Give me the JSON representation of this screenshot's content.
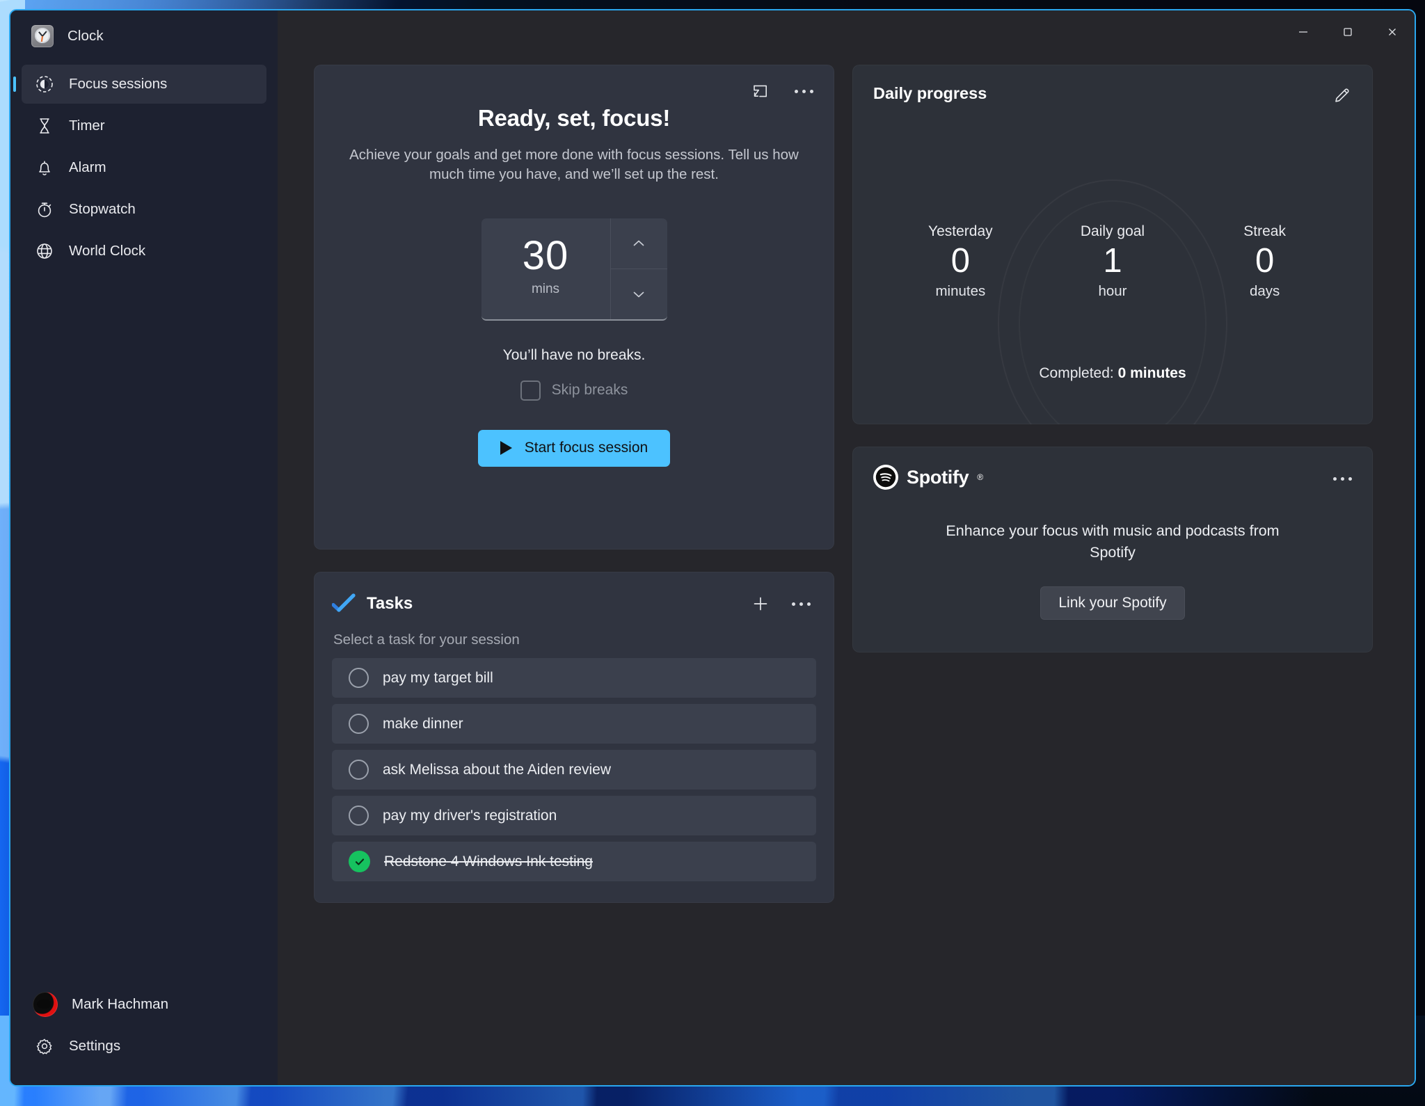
{
  "window": {
    "app_title": "Clock",
    "app_icon": "clock-icon",
    "controls": {
      "minimize": "minimize-icon",
      "maximize": "maximize-icon",
      "close": "close-icon"
    }
  },
  "sidebar": {
    "items": [
      {
        "label": "Focus sessions",
        "icon": "focus-sessions-icon",
        "active": true
      },
      {
        "label": "Timer",
        "icon": "hourglass-icon",
        "active": false
      },
      {
        "label": "Alarm",
        "icon": "bell-icon",
        "active": false
      },
      {
        "label": "Stopwatch",
        "icon": "stopwatch-icon",
        "active": false
      },
      {
        "label": "World Clock",
        "icon": "globe-icon",
        "active": false
      }
    ],
    "user": {
      "name": "Mark Hachman",
      "avatar": "user-avatar"
    },
    "settings": {
      "label": "Settings",
      "icon": "gear-icon"
    }
  },
  "focus": {
    "title": "Ready, set, focus!",
    "subtitle": "Achieve your goals and get more done with focus sessions. Tell us how much time you have, and we’ll set up the rest.",
    "duration_value": "30",
    "duration_unit": "mins",
    "increase_icon": "chevron-up-icon",
    "decrease_icon": "chevron-down-icon",
    "breaks_text": "You’ll have no breaks.",
    "skip_breaks_label": "Skip breaks",
    "skip_breaks_checked": false,
    "start_label": "Start focus session",
    "start_icon": "play-icon",
    "accent_color": "#4CC2FF",
    "compact_icon": "compact-overlay-icon",
    "more_icon": "more-options-icon"
  },
  "tasks": {
    "title": "Tasks",
    "logo_icon": "microsoft-todo-icon",
    "add_icon": "plus-icon",
    "more_icon": "more-options-icon",
    "subtitle": "Select a task for your session",
    "items": [
      {
        "label": "pay my target bill",
        "completed": false
      },
      {
        "label": "make dinner",
        "completed": false
      },
      {
        "label": "ask Melissa about the Aiden review",
        "completed": false
      },
      {
        "label": "pay my driver's registration",
        "completed": false
      },
      {
        "label": "Redstone 4 Windows Ink testing",
        "completed": true
      }
    ],
    "completed_color": "#16C25F"
  },
  "daily_progress": {
    "title": "Daily progress",
    "edit_icon": "pencil-edit-icon",
    "stats": [
      {
        "label": "Yesterday",
        "value": "0",
        "unit": "minutes"
      },
      {
        "label": "Daily goal",
        "value": "1",
        "unit": "hour"
      },
      {
        "label": "Streak",
        "value": "0",
        "unit": "days"
      }
    ],
    "completed_prefix": "Completed: ",
    "completed_value": "0 minutes"
  },
  "spotify": {
    "brand": "Spotify",
    "trademark": "®",
    "logo_icon": "spotify-icon",
    "more_icon": "more-options-icon",
    "description": "Enhance your focus with music and podcasts from Spotify",
    "link_button": "Link your Spotify"
  }
}
